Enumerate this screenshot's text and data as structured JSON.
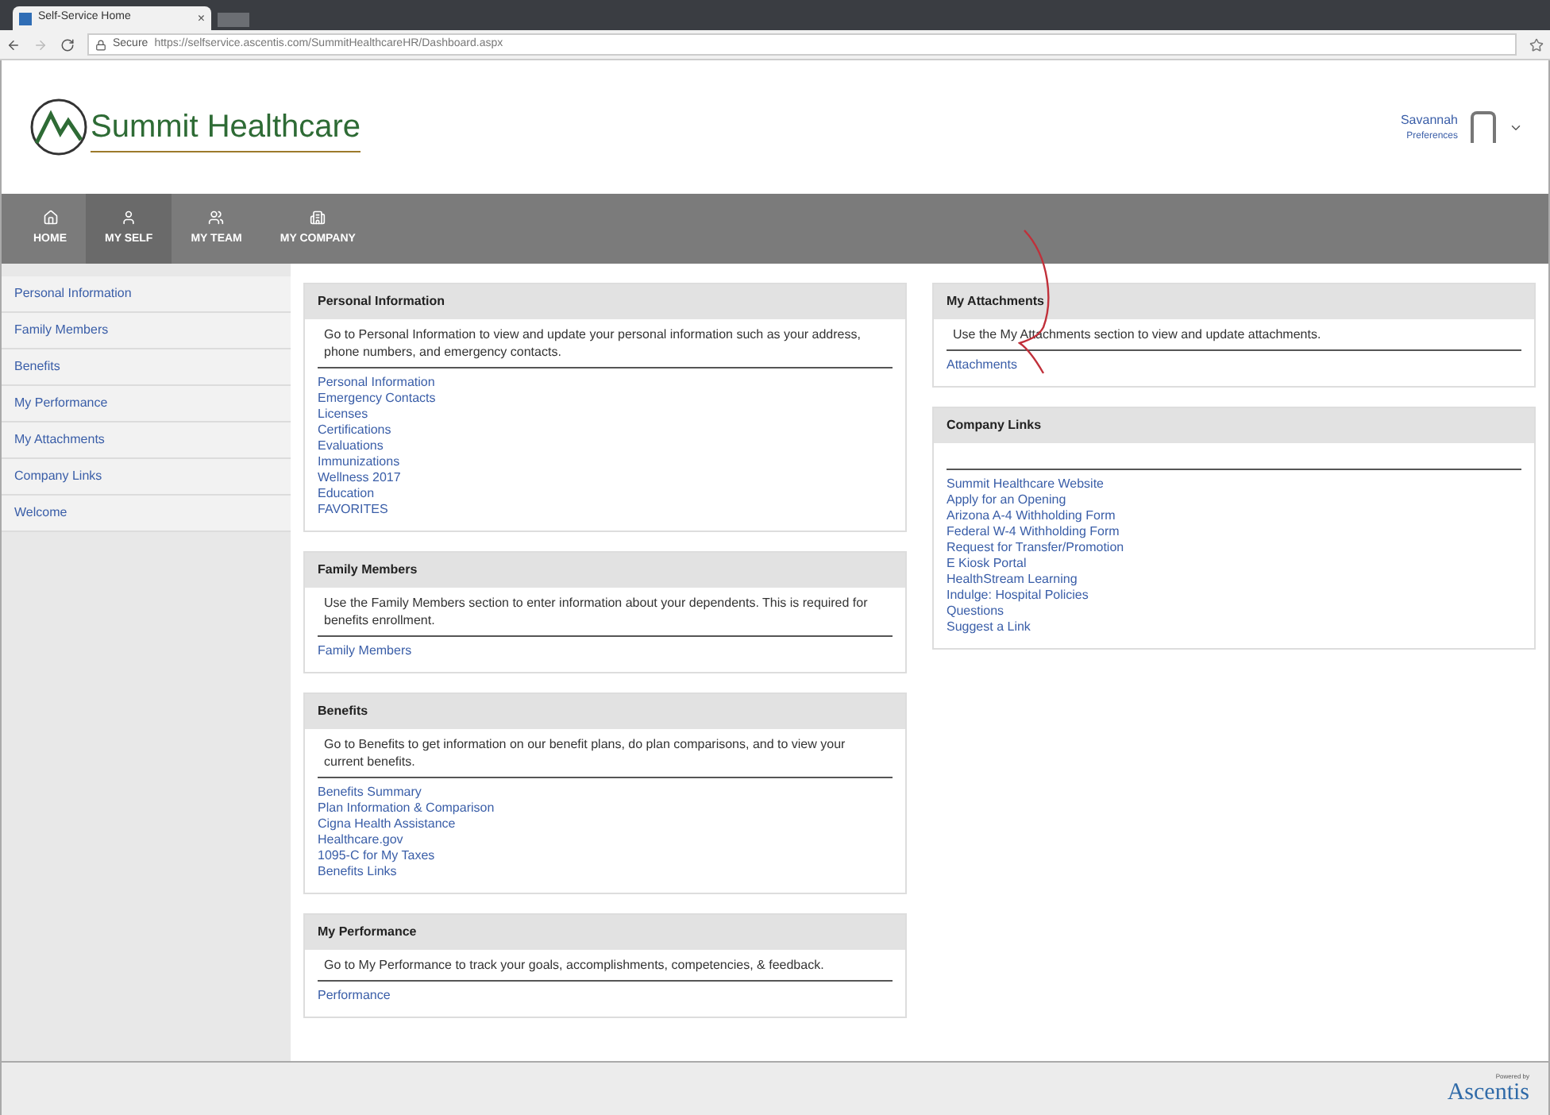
{
  "browser": {
    "tab_title": "Self-Service Home",
    "tab_close": "×",
    "secure": "Secure",
    "url": "https://selfservice.ascentis.com/SummitHealthcareHR/Dashboard.aspx"
  },
  "header": {
    "logo": "Summit Healthcare",
    "user_name": "Savannah",
    "user_link": "Preferences"
  },
  "nav": [
    {
      "label": "HOME",
      "selected": false
    },
    {
      "label": "MY SELF",
      "selected": true
    },
    {
      "label": "MY TEAM",
      "selected": false
    },
    {
      "label": "MY COMPANY",
      "selected": false
    }
  ],
  "sidebar": [
    "Personal Information",
    "Family Members",
    "Benefits",
    "My Performance",
    "My Attachments",
    "Company Links",
    "Welcome"
  ],
  "columns": [
    [
      {
        "title": "Personal Information",
        "description": "Go to Personal Information to view and update your personal information such as your address, phone numbers, and emergency contacts.",
        "links": [
          "Personal Information",
          "Emergency Contacts",
          "Licenses",
          "Certifications",
          "Evaluations",
          "Immunizations",
          "Wellness 2017",
          "Education",
          "FAVORITES"
        ]
      },
      {
        "title": "Family Members",
        "description": "Use the Family Members section to enter information about your dependents. This is required for benefits enrollment.",
        "links": [
          "Family Members"
        ]
      },
      {
        "title": "Benefits",
        "description": "Go to Benefits to get information on our benefit plans, do plan comparisons, and to view your current benefits.",
        "links": [
          "Benefits Summary",
          "Plan Information & Comparison",
          "Cigna Health Assistance",
          "Healthcare.gov",
          "1095-C for My Taxes",
          "Benefits Links"
        ]
      },
      {
        "title": "My Performance",
        "description": "Go to My Performance to track your goals, accomplishments, competencies, & feedback.",
        "links": [
          "Performance"
        ]
      }
    ],
    [
      {
        "title": "My Attachments",
        "description": "Use the My Attachments section to view and update attachments.",
        "links": [
          "Attachments"
        ]
      },
      {
        "title": "Company Links",
        "links": [
          "Summit Healthcare Website",
          "Apply for an Opening",
          "Arizona A-4 Withholding Form",
          "Federal W-4 Withholding Form",
          "Request for Transfer/Promotion",
          "E Kiosk Portal",
          "HealthStream Learning",
          "Indulge: Hospital Policies",
          "Questions",
          "Suggest a Link"
        ]
      }
    ]
  ],
  "footer": {
    "powered_by": "Powered by",
    "brand": "Ascentis"
  }
}
